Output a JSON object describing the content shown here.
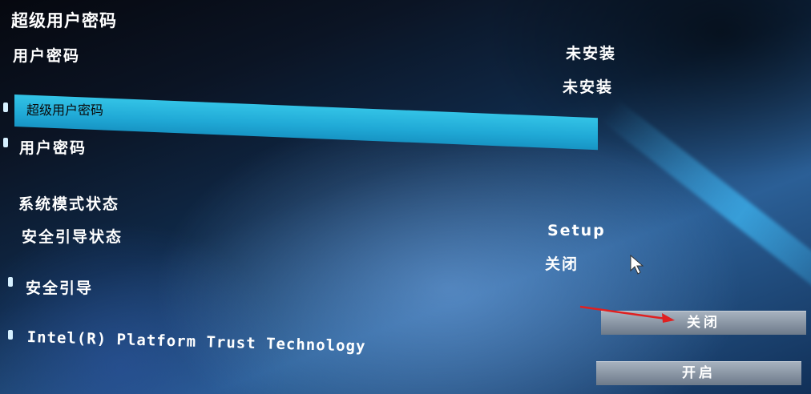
{
  "page_title": "超级用户密码",
  "status_rows": [
    {
      "label": "用户密码",
      "value": "未安装"
    },
    {
      "value": "未安装"
    }
  ],
  "menu": {
    "selected_item": "超级用户密码",
    "user_password": "用户密码"
  },
  "system_info": [
    {
      "label": "系统模式状态",
      "value": "Setup"
    },
    {
      "label": "安全引导状态",
      "value": "关闭"
    }
  ],
  "secure_boot": {
    "label": "安全引导"
  },
  "ptt": {
    "label": "Intel(R) Platform Trust Technology"
  },
  "options": {
    "off": "关闭",
    "on": "开启"
  },
  "icons": {
    "pointer": "mouse-pointer-icon",
    "annotation": "red-arrow-icon"
  },
  "colors": {
    "highlight": "#20a9d6",
    "annotation_arrow": "#e02020",
    "button": "#8591a0"
  }
}
